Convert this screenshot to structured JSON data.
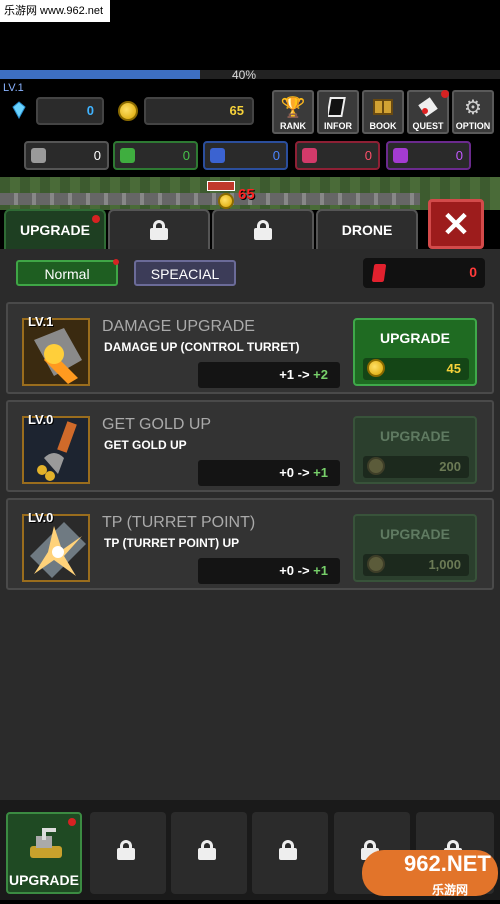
{
  "watermark_top": "乐游网 www.962.net",
  "progress": {
    "level": "LV.1",
    "xp_percent_label": "40%",
    "xp_fraction": 0.4
  },
  "currency": {
    "gems": "0",
    "gold": "65"
  },
  "top_buttons": [
    {
      "label": "RANK",
      "icon": "trophy-icon"
    },
    {
      "label": "INFOR",
      "icon": "info-card-icon"
    },
    {
      "label": "BOOK",
      "icon": "book-icon"
    },
    {
      "label": "QUEST",
      "icon": "scroll-icon"
    },
    {
      "label": "OPTION",
      "icon": "gear-icon"
    }
  ],
  "resources": [
    {
      "color": "#9a9a9a",
      "value": "0"
    },
    {
      "color": "#3fae3f",
      "value": "0"
    },
    {
      "color": "#3b63d1",
      "value": "0"
    },
    {
      "color": "#d23a6a",
      "value": "0"
    },
    {
      "color": "#a43bd1",
      "value": "0"
    }
  ],
  "scene": {
    "damage": "65"
  },
  "tabs": [
    {
      "label": "UPGRADE",
      "locked": false,
      "active": true
    },
    {
      "label": "",
      "locked": true
    },
    {
      "label": "",
      "locked": true
    },
    {
      "label": "DRONE",
      "locked": false
    }
  ],
  "modes": {
    "normal": "Normal",
    "special": "SPEACIAL"
  },
  "ruby": "0",
  "upgrades": [
    {
      "level": "LV.1",
      "title": "DAMAGE UPGRADE",
      "desc": "DAMAGE UP (CONTROL TURRET)",
      "from": "+1 ->",
      "to": "+2",
      "button": "UPGRADE",
      "cost": "45",
      "enabled": true
    },
    {
      "level": "LV.0",
      "title": "GET GOLD UP",
      "desc": "GET GOLD UP",
      "from": "+0 ->",
      "to": "+1",
      "button": "UPGRADE",
      "cost": "200",
      "enabled": false
    },
    {
      "level": "LV.0",
      "title": "TP (TURRET POINT)",
      "desc": "TP (TURRET POINT) UP",
      "from": "+0 ->",
      "to": "+1",
      "button": "UPGRADE",
      "cost": "1,000",
      "enabled": false
    }
  ],
  "bottom_nav": {
    "active_label": "UPGRADE"
  },
  "watermark_br": {
    "main": "962.NET",
    "sub": "乐游网"
  }
}
